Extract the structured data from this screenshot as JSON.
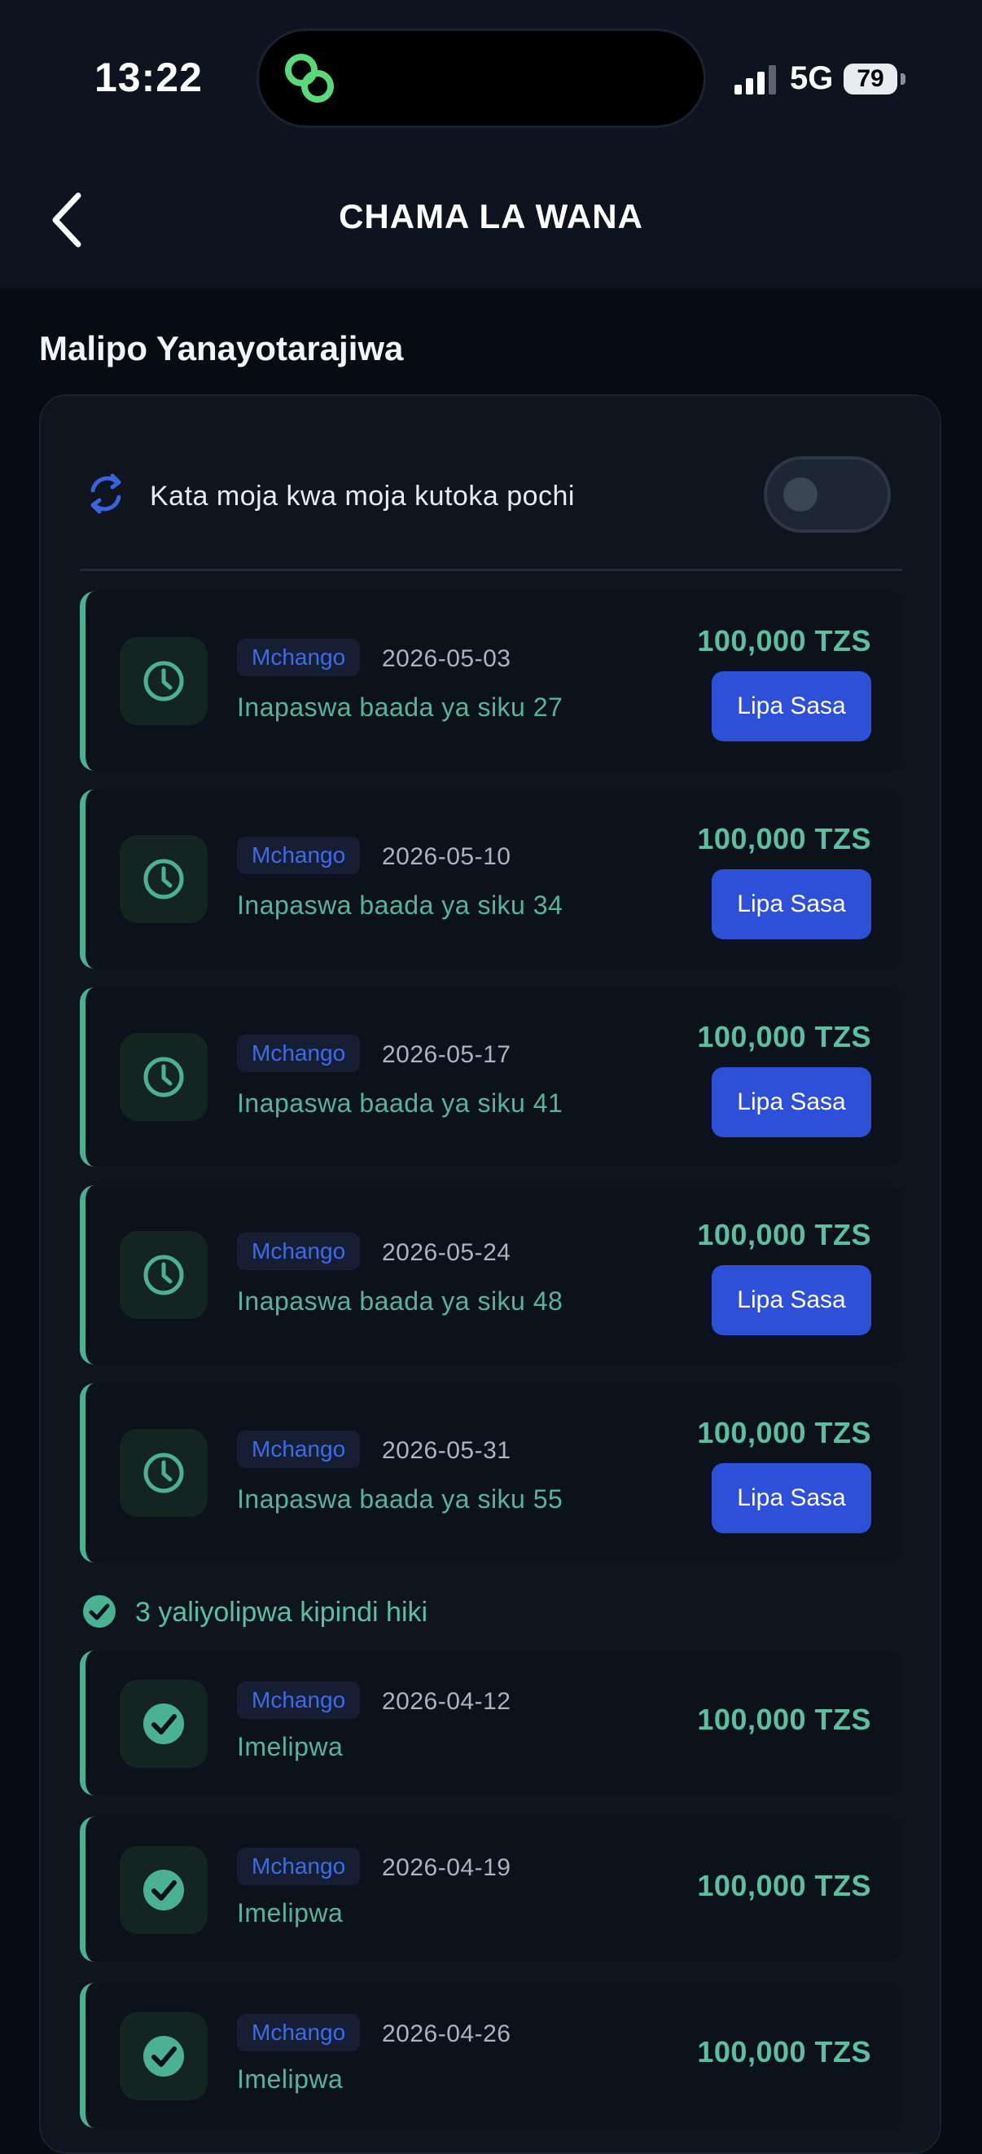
{
  "status_bar": {
    "time": "13:22",
    "network": "5G",
    "battery": "79"
  },
  "header": {
    "title": "CHAMA LA WANA"
  },
  "section": {
    "title": "Malipo Yanayotarajiwa"
  },
  "auto_deduct": {
    "label": "Kata moja kwa moja kutoka pochi",
    "enabled": false
  },
  "upcoming": [
    {
      "badge": "Mchango",
      "date": "2026-05-03",
      "due": "Inapaswa baada ya siku 27",
      "amount": "100,000 TZS",
      "button": "Lipa Sasa"
    },
    {
      "badge": "Mchango",
      "date": "2026-05-10",
      "due": "Inapaswa baada ya siku 34",
      "amount": "100,000 TZS",
      "button": "Lipa Sasa"
    },
    {
      "badge": "Mchango",
      "date": "2026-05-17",
      "due": "Inapaswa baada ya siku 41",
      "amount": "100,000 TZS",
      "button": "Lipa Sasa"
    },
    {
      "badge": "Mchango",
      "date": "2026-05-24",
      "due": "Inapaswa baada ya siku 48",
      "amount": "100,000 TZS",
      "button": "Lipa Sasa"
    },
    {
      "badge": "Mchango",
      "date": "2026-05-31",
      "due": "Inapaswa baada ya siku 55",
      "amount": "100,000 TZS",
      "button": "Lipa Sasa"
    }
  ],
  "paid_summary": "3 yaliyolipwa kipindi hiki",
  "paid": [
    {
      "badge": "Mchango",
      "date": "2026-04-12",
      "status": "Imelipwa",
      "amount": "100,000 TZS"
    },
    {
      "badge": "Mchango",
      "date": "2026-04-19",
      "status": "Imelipwa",
      "amount": "100,000 TZS"
    },
    {
      "badge": "Mchango",
      "date": "2026-04-26",
      "status": "Imelipwa",
      "amount": "100,000 TZS"
    }
  ],
  "colors": {
    "accent_green": "#5bc0a0",
    "button_blue": "#2e4fd8",
    "badge_blue": "#3e6be8",
    "background": "#070b12"
  },
  "icons": {
    "pending": "clock-icon",
    "paid": "check-circle-icon",
    "auto": "refresh-icon",
    "back": "chevron-left-icon"
  }
}
